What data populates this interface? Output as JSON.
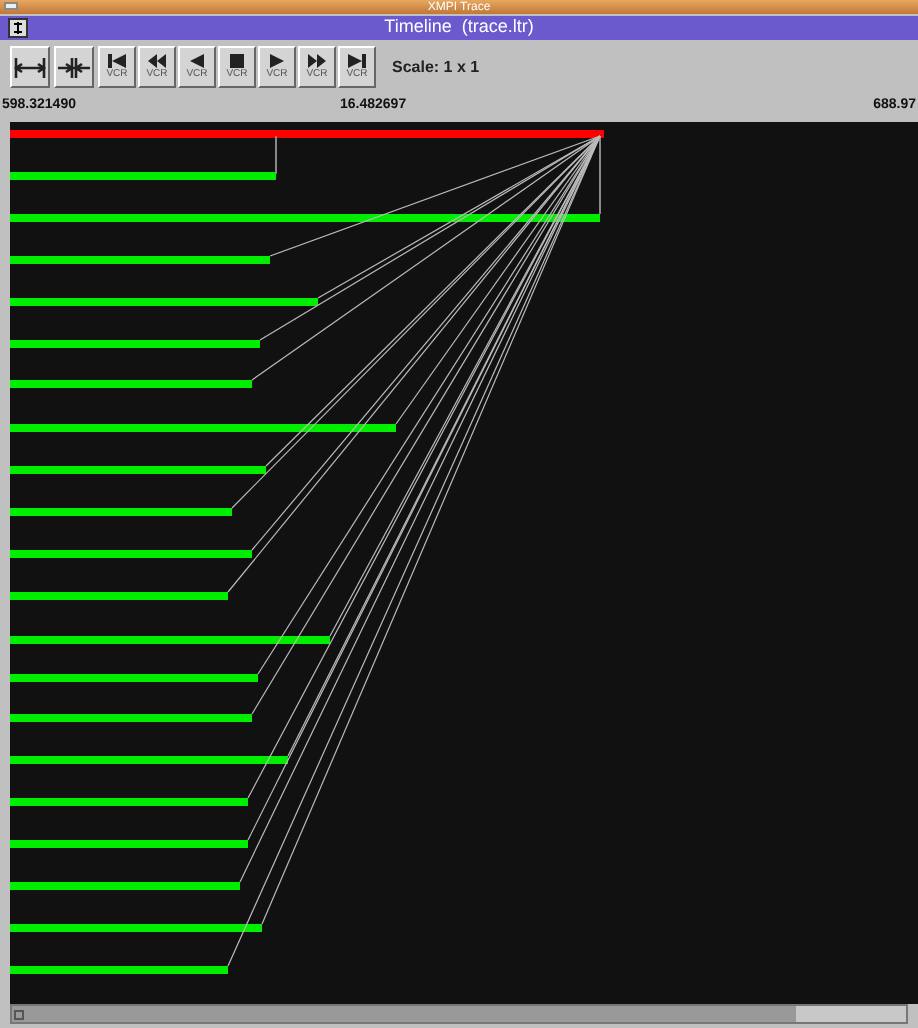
{
  "window": {
    "title": "XMPI Trace"
  },
  "subwindow": {
    "title": "Timeline  (trace.ltr)"
  },
  "toolbar": {
    "buttons": [
      {
        "kind": "zoom_out"
      },
      {
        "kind": "zoom_in"
      },
      {
        "kind": "first",
        "label": "VCR"
      },
      {
        "kind": "rewind",
        "label": "VCR"
      },
      {
        "kind": "back",
        "label": "VCR"
      },
      {
        "kind": "stop",
        "label": "VCR"
      },
      {
        "kind": "play",
        "label": "VCR"
      },
      {
        "kind": "fast_forward",
        "label": "VCR"
      },
      {
        "kind": "last",
        "label": "VCR"
      }
    ],
    "scale": "Scale: 1 x 1"
  },
  "time_axis": {
    "start": "598.321490",
    "span": "16.482697",
    "end": "688.97"
  }
}
